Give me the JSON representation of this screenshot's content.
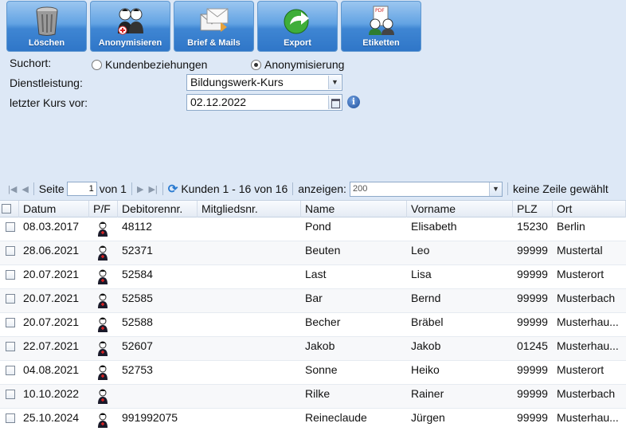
{
  "toolbar": {
    "buttons": [
      {
        "label": "Löschen",
        "icon": "trash-icon"
      },
      {
        "label": "Anonymisieren",
        "icon": "anonymize-users-icon"
      },
      {
        "label": "Brief & Mails",
        "icon": "letters-mail-icon"
      },
      {
        "label": "Export",
        "icon": "export-arrow-icon"
      },
      {
        "label": "Etiketten",
        "icon": "pdf-labels-icon"
      }
    ]
  },
  "form": {
    "suchort_label": "Suchort:",
    "radio_kunden": "Kundenbeziehungen",
    "radio_anonym": "Anonymisierung",
    "selected_radio": "Anonymisierung",
    "dienstleistung_label": "Dienstleistung:",
    "dienstleistung_value": "Bildungswerk-Kurs",
    "letzter_kurs_label": "letzter Kurs vor:",
    "letzter_kurs_value": "02.12.2022",
    "info_icon": "i"
  },
  "pager": {
    "page_label": "Seite",
    "page_value": "1",
    "of_label": "von 1",
    "range_text": "Kunden 1 - 16 von 16",
    "show_label": "anzeigen:",
    "show_value": "200",
    "selection_text": "keine Zeile gewählt"
  },
  "grid": {
    "columns": [
      "Datum",
      "P/F",
      "Debitorennr.",
      "Mitgliedsnr.",
      "Name",
      "Vorname",
      "PLZ",
      "Ort"
    ],
    "rows": [
      {
        "datum": "08.03.2017",
        "debitor": "48112",
        "mitglied": "",
        "name": "Pond",
        "vorname": "Elisabeth",
        "plz": "15230",
        "ort": "Berlin"
      },
      {
        "datum": "28.06.2021",
        "debitor": "52371",
        "mitglied": "",
        "name": "Beuten",
        "vorname": "Leo",
        "plz": "99999",
        "ort": "Mustertal"
      },
      {
        "datum": "20.07.2021",
        "debitor": "52584",
        "mitglied": "",
        "name": "Last",
        "vorname": "Lisa",
        "plz": "99999",
        "ort": "Musterort"
      },
      {
        "datum": "20.07.2021",
        "debitor": "52585",
        "mitglied": "",
        "name": "Bar",
        "vorname": "Bernd",
        "plz": "99999",
        "ort": "Musterbach"
      },
      {
        "datum": "20.07.2021",
        "debitor": "52588",
        "mitglied": "",
        "name": "Becher",
        "vorname": "Bräbel",
        "plz": "99999",
        "ort": "Musterhau..."
      },
      {
        "datum": "22.07.2021",
        "debitor": "52607",
        "mitglied": "",
        "name": "Jakob",
        "vorname": "Jakob",
        "plz": "01245",
        "ort": "Musterhau..."
      },
      {
        "datum": "04.08.2021",
        "debitor": "52753",
        "mitglied": "",
        "name": "Sonne",
        "vorname": "Heiko",
        "plz": "99999",
        "ort": "Musterort"
      },
      {
        "datum": "10.10.2022",
        "debitor": "",
        "mitglied": "",
        "name": "Rilke",
        "vorname": "Rainer",
        "plz": "99999",
        "ort": "Musterbach"
      },
      {
        "datum": "25.10.2024",
        "debitor": "991992075",
        "mitglied": "",
        "name": "Reineclaude",
        "vorname": "Jürgen",
        "plz": "99999",
        "ort": "Musterhau..."
      }
    ],
    "pf_icon": "person-icon"
  },
  "colors": {
    "toolbar_blue": "#3f86d3",
    "background": "#dde8f6",
    "grid_header": "#e4ebf4"
  }
}
